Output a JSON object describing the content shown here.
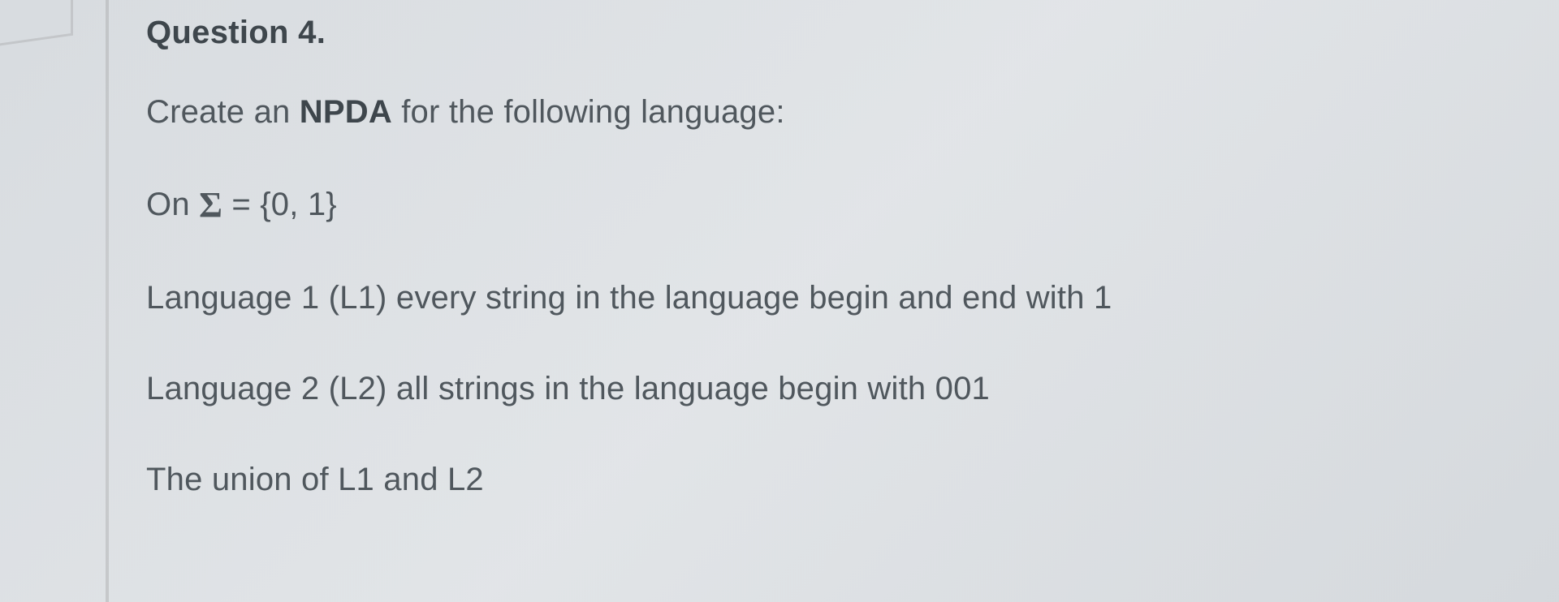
{
  "question": {
    "heading": "Question 4.",
    "intro_prefix": "Create an ",
    "intro_strong": "NPDA",
    "intro_suffix": "  for the following language:",
    "alphabet_prefix": "On ",
    "alphabet_sigma": "Σ",
    "alphabet_eq": " = {0, 1}",
    "lang1": "Language 1 (L1) every string in the language begin and end with 1",
    "lang2": "Language 2 (L2) all strings in the language begin with 001",
    "union": "The union of L1 and L2"
  }
}
